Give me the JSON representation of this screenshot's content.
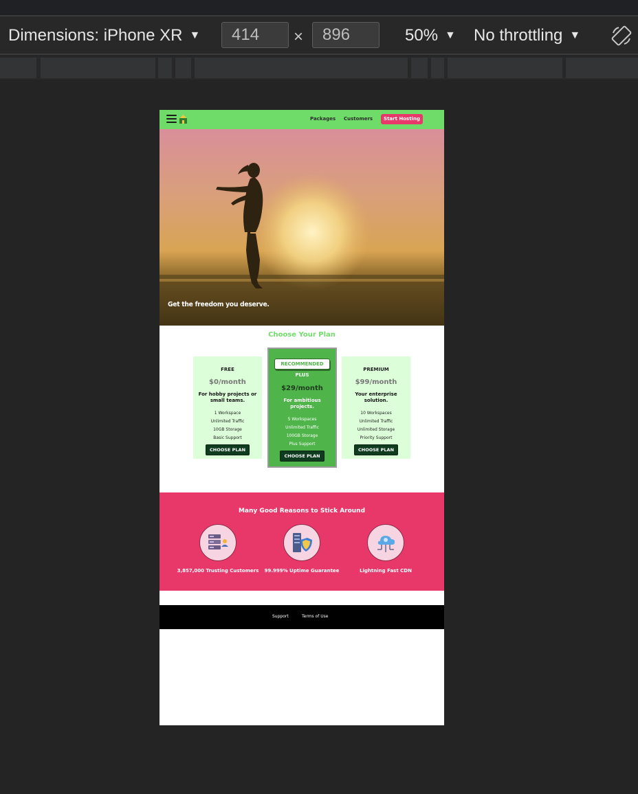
{
  "devtools": {
    "dimensions_label": "Dimensions: iPhone XR",
    "width": "414",
    "height": "896",
    "times": "×",
    "zoom": "50%",
    "throttling": "No throttling"
  },
  "page": {
    "nav": {
      "links": [
        "Packages",
        "Customers"
      ],
      "cta": "Start Hosting"
    },
    "hero": {
      "tagline": "Get the freedom you deserve."
    },
    "plans": {
      "title": "Choose Your Plan",
      "items": [
        {
          "name": "FREE",
          "price": "$0/month",
          "description": "For hobby projects or small teams.",
          "features": [
            "1 Workspace",
            "Unlimited Traffic",
            "10GB Storage",
            "Basic Support"
          ],
          "button": "CHOOSE PLAN"
        },
        {
          "badge": "RECOMMENDED",
          "name": "PLUS",
          "price": "$29/month",
          "description": "For ambitious projects.",
          "features": [
            "5 Workspaces",
            "Unlimited Traffic",
            "100GB Storage",
            "Plus Support"
          ],
          "button": "CHOOSE PLAN"
        },
        {
          "name": "PREMIUM",
          "price": "$99/month",
          "description": "Your enterprise solution.",
          "features": [
            "10 Workspaces",
            "Unlimited Traffic",
            "Unlimited Storage",
            "Priority Support"
          ],
          "button": "CHOOSE PLAN"
        }
      ]
    },
    "reasons": {
      "title": "Many Good Reasons to Stick Around",
      "items": [
        {
          "label": "3,857,000 Trusting Customers",
          "icon": "customers-servers-icon"
        },
        {
          "label": "99.999% Uptime Guarantee",
          "icon": "shield-server-icon"
        },
        {
          "label": "Lightning Fast CDN",
          "icon": "cloud-cdn-icon"
        }
      ]
    },
    "footer": {
      "links": [
        "Support",
        "Terms of Use"
      ]
    }
  },
  "colors": {
    "devtools_bg": "#242424",
    "nav_green": "#6fdc6a",
    "accent_pink": "#e8386a",
    "plan_light": "#dcffd9",
    "plan_recommended": "#4fb54a",
    "button_dark": "#0f3b1e"
  }
}
